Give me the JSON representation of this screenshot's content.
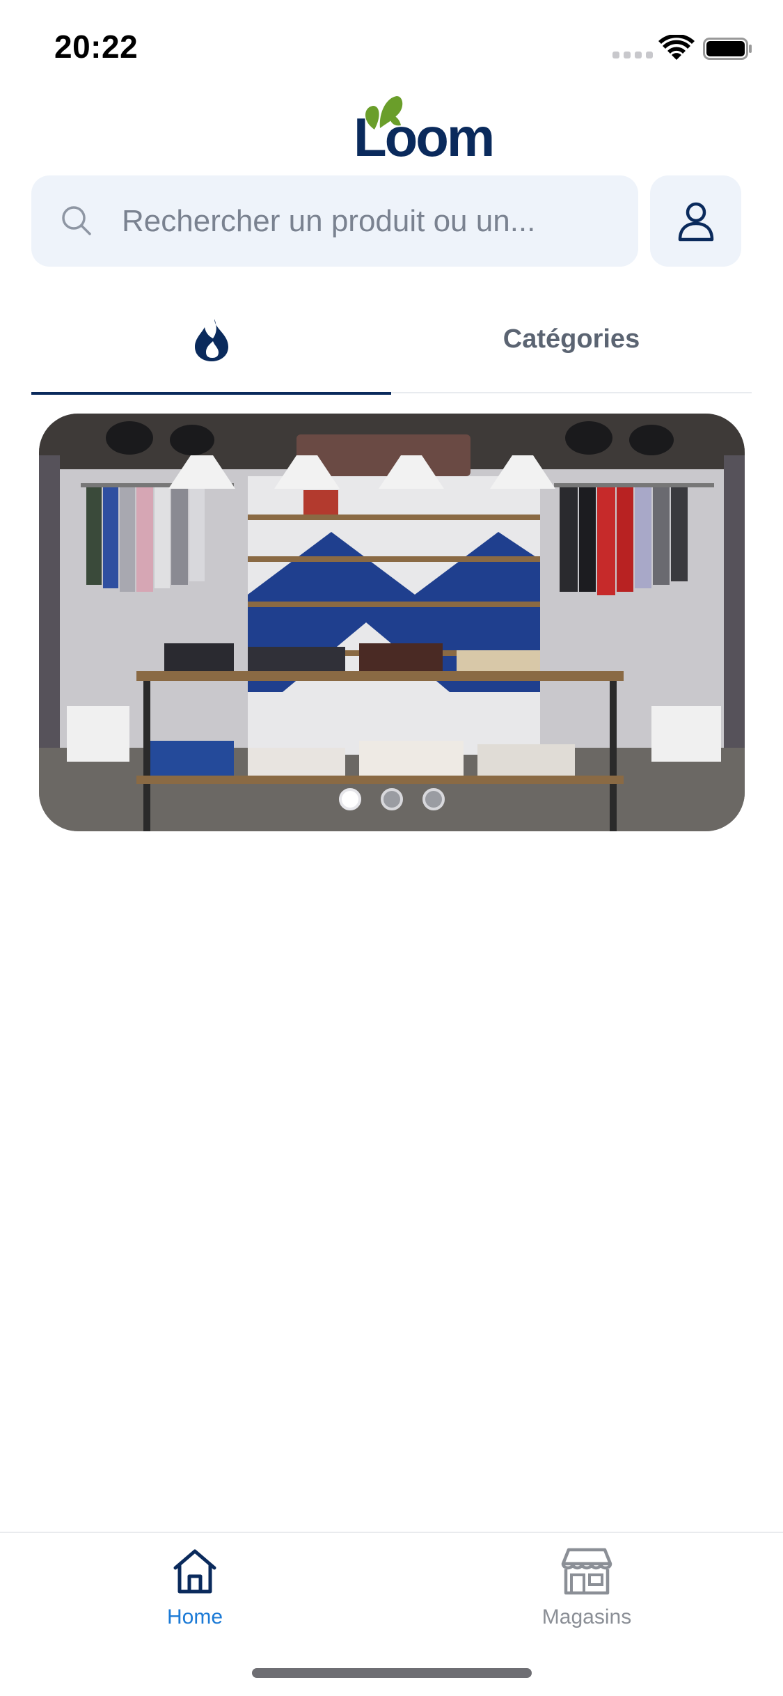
{
  "status_bar": {
    "time": "20:22"
  },
  "header": {
    "logo_text": "Loom"
  },
  "search": {
    "placeholder": "Rechercher un produit ou un...",
    "value": ""
  },
  "tabs": [
    {
      "id": "trending",
      "label": "",
      "icon": "flame-icon",
      "active": true
    },
    {
      "id": "categories",
      "label": "Catégories",
      "active": false
    }
  ],
  "carousel": {
    "slide_count": 3,
    "active_index": 0
  },
  "bottom_nav": [
    {
      "label": "Home",
      "icon": "home-icon",
      "active": true
    },
    {
      "label": "Magasins",
      "icon": "store-icon",
      "active": false
    }
  ],
  "colors": {
    "brand_navy": "#0a2a5c",
    "brand_green": "#6a9e2a",
    "active_blue": "#1b7ad6",
    "search_bg": "#eef3fa"
  }
}
